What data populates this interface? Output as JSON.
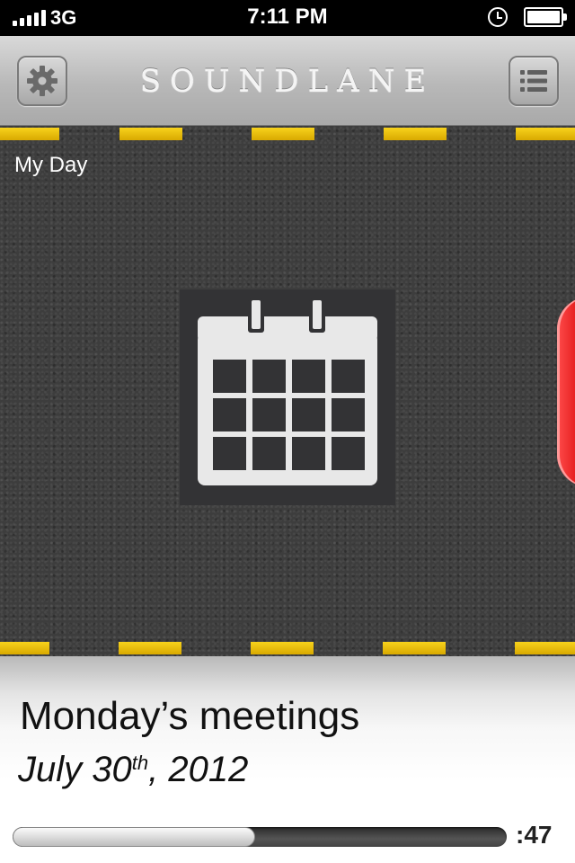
{
  "status_bar": {
    "carrier": "3G",
    "time": "7:11 PM"
  },
  "nav_bar": {
    "title": "SOUNDLANE",
    "left_icon": "gear-icon",
    "right_icon": "list-icon"
  },
  "road": {
    "lane_color": "#f5c800",
    "asphalt_color": "#3d3d3d",
    "label": "My Day",
    "center_icon": "calendar-icon",
    "side_tab_color": "#d40000"
  },
  "info": {
    "title": "Monday’s meetings",
    "date_prefix": "July 30",
    "date_suffix": "th",
    "date_year": ", 2012",
    "progress_fraction": 0.49,
    "remaining": ":47"
  }
}
